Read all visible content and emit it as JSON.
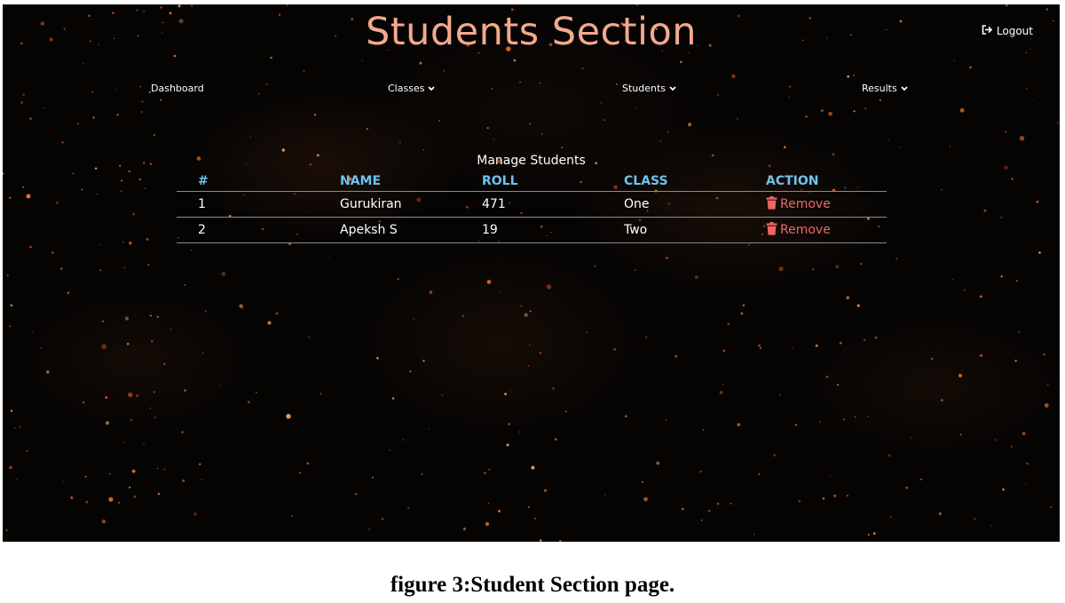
{
  "header": {
    "title": "Students Section",
    "logout_label": "Logout",
    "logout_icon": "sign-out-icon"
  },
  "nav": {
    "items": [
      {
        "label": "Dashboard",
        "has_dropdown": false
      },
      {
        "label": "Classes",
        "has_dropdown": true
      },
      {
        "label": "Students",
        "has_dropdown": true
      },
      {
        "label": "Results",
        "has_dropdown": true
      }
    ]
  },
  "table": {
    "caption": "Manage Students",
    "headers": [
      "#",
      "NAME",
      "ROLL",
      "CLASS",
      "ACTION"
    ],
    "rows": [
      {
        "num": "1",
        "name": "Gurukiran",
        "roll": "471",
        "class": "One",
        "action": "Remove"
      },
      {
        "num": "2",
        "name": "Apeksh S",
        "roll": "19",
        "class": "Two",
        "action": "Remove"
      }
    ]
  },
  "colors": {
    "title": "#f2a98d",
    "header_text": "#6ec3ee",
    "remove": "#f06565",
    "background": "#050403"
  },
  "figure_caption": "figure 3:Student Section page."
}
